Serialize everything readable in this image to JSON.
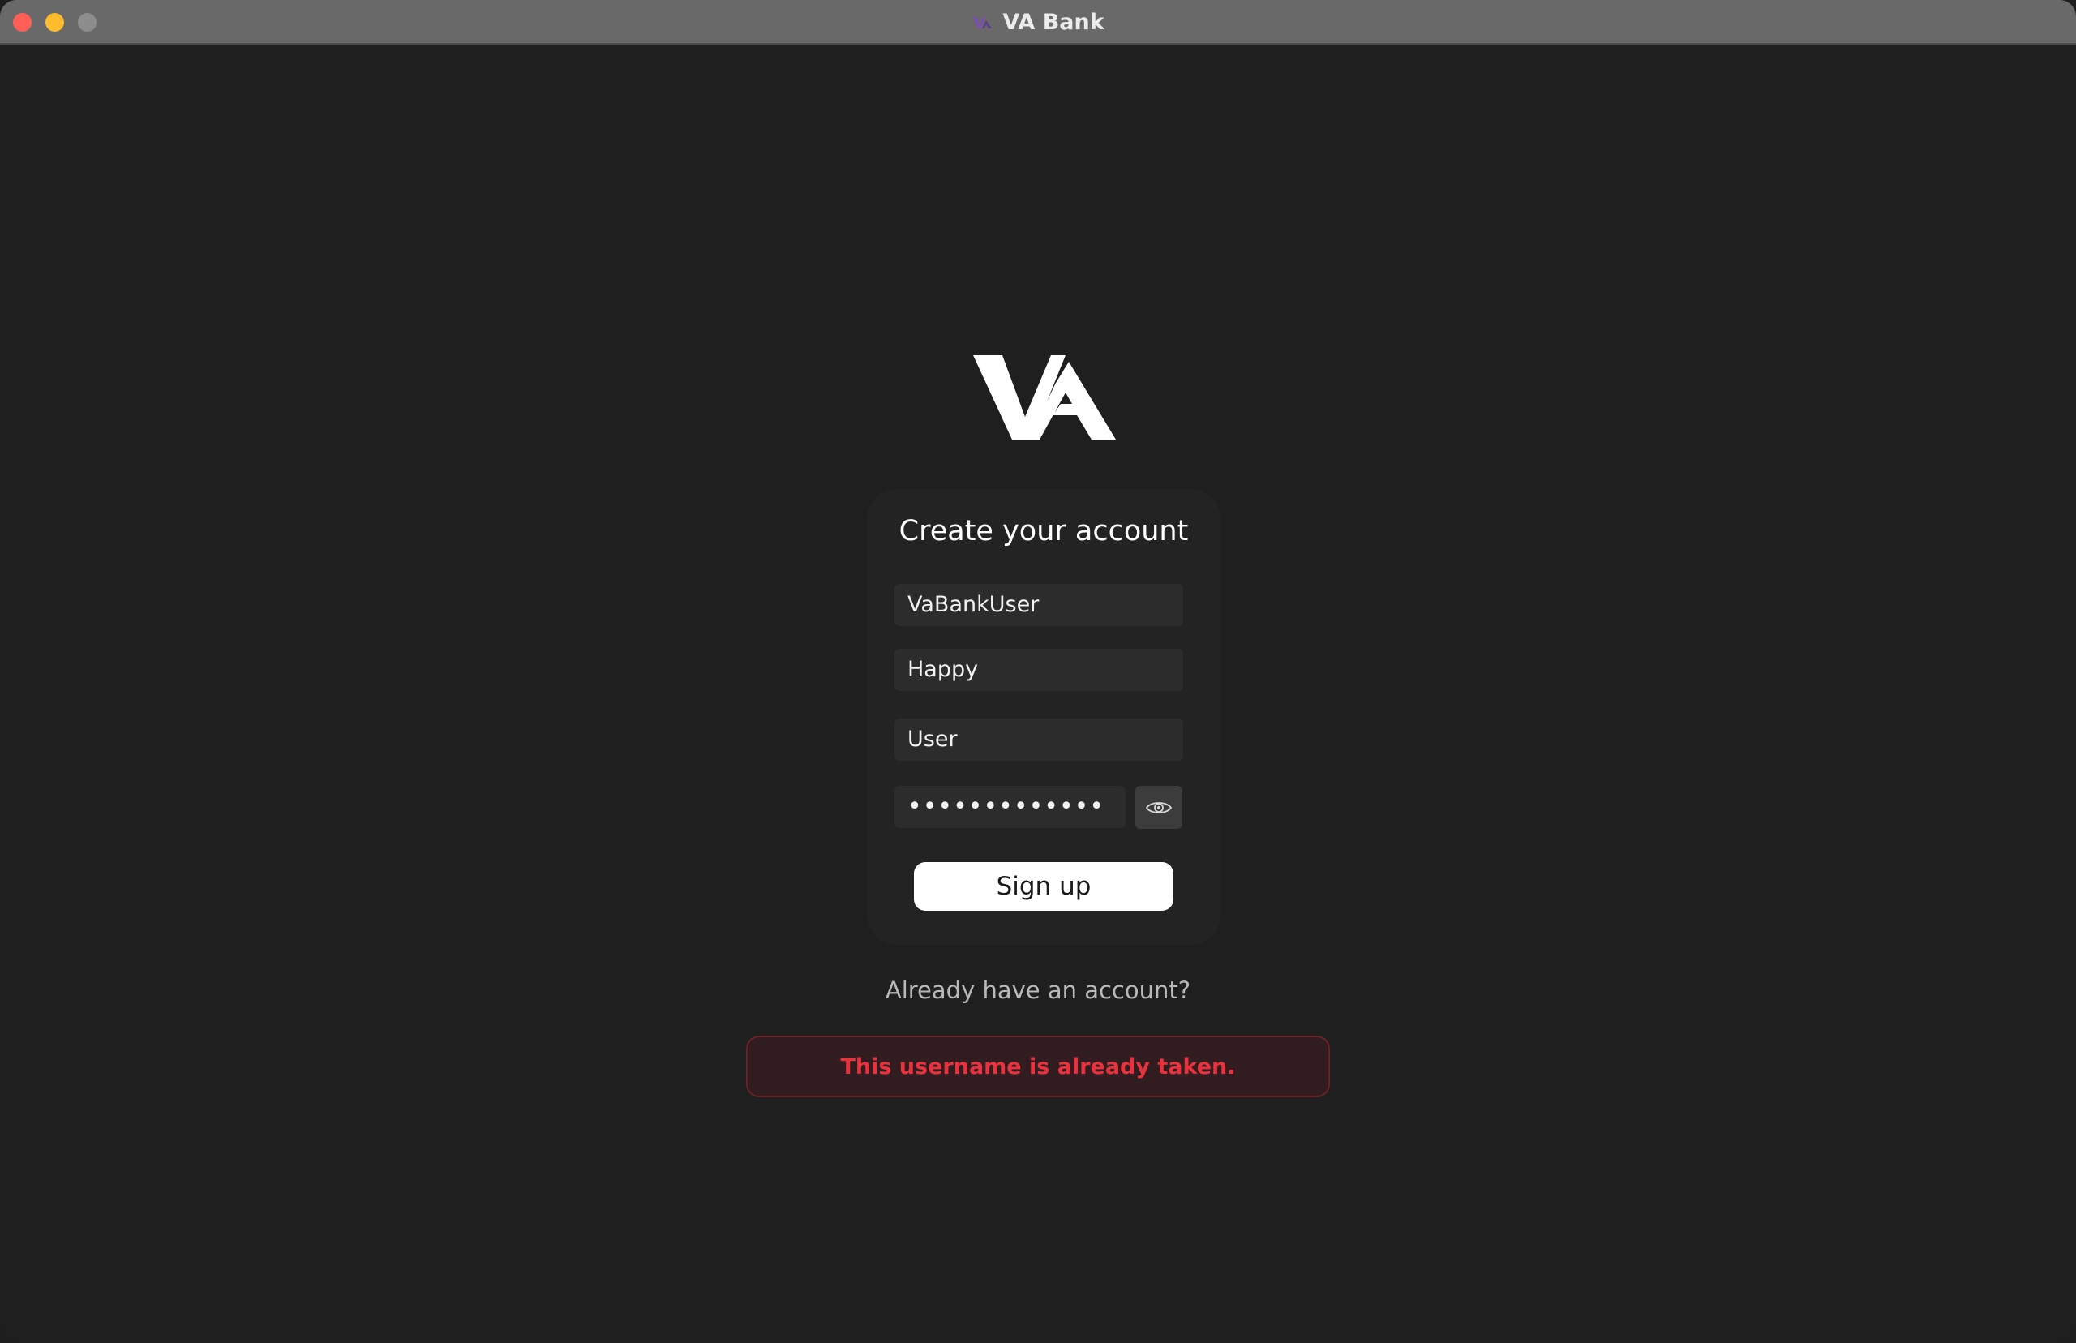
{
  "window": {
    "title": "VA Bank"
  },
  "logo": {
    "icon": "va-logo-icon"
  },
  "form": {
    "heading": "Create your account",
    "username_value": "VaBankUser",
    "first_name_value": "Happy",
    "last_name_value": "User",
    "password_masked": "•••••••••••••",
    "show_password_icon": "eye-icon",
    "submit_label": "Sign up"
  },
  "signin_link": "Already have an account?",
  "error": {
    "message": "This username is already taken."
  },
  "colors": {
    "background": "#1f1f1f",
    "card": "#232323",
    "field": "#2c2c2c",
    "error_text": "#e8323d",
    "error_border": "#6b2128",
    "error_bg": "#311c1f",
    "title_logo_accent": "#7a4fb0"
  }
}
